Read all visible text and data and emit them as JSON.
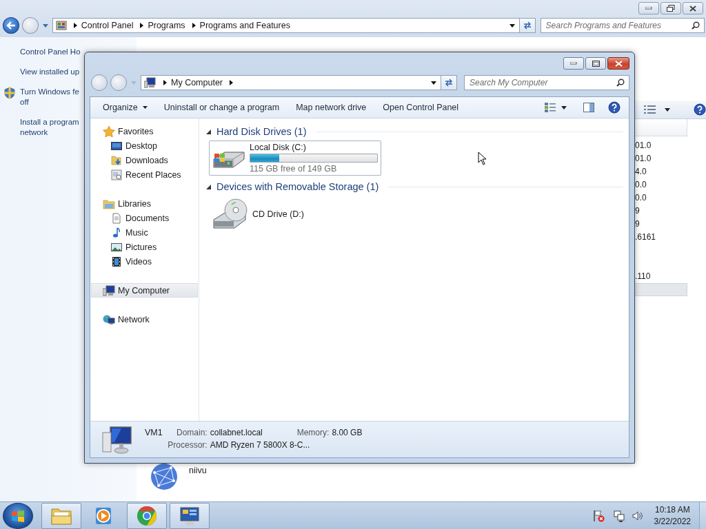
{
  "back_window": {
    "breadcrumb": [
      "Control Panel",
      "Programs",
      "Programs and Features"
    ],
    "search": {
      "placeholder": "Search Programs and Features"
    },
    "tasks": [
      {
        "lines": [
          "Control Panel Ho"
        ],
        "shield": false
      },
      {
        "lines": [
          "View installed up"
        ],
        "shield": false
      },
      {
        "lines": [
          "Turn Windows fe",
          "off"
        ],
        "shield": true
      },
      {
        "lines": [
          "Install a program",
          "network"
        ],
        "shield": false
      }
    ],
    "rows": [
      {
        "version": "01.0",
        "selected": false
      },
      {
        "version": "01.0",
        "selected": false
      },
      {
        "version": "4.0",
        "selected": false
      },
      {
        "version": "0.0",
        "selected": false
      },
      {
        "version": "0.0",
        "selected": false
      },
      {
        "version": "9",
        "selected": false
      },
      {
        "version": "9",
        "selected": false
      },
      {
        "version": ".6161",
        "selected": false
      },
      {
        "selected": false
      },
      {
        "selected": false
      },
      {
        "version": ".110",
        "selected": false
      },
      {
        "selected": true
      }
    ],
    "details": {
      "name": "niivu"
    }
  },
  "window": {
    "address": [
      "My Computer"
    ],
    "search": {
      "placeholder": "Search My Computer"
    },
    "toolbar": [
      {
        "label": "Organize",
        "menu": true
      },
      {
        "label": "Uninstall or change a program",
        "menu": false
      },
      {
        "label": "Map network drive",
        "menu": false
      },
      {
        "label": "Open Control Panel",
        "menu": false
      }
    ],
    "nav": [
      {
        "label": "Favorites",
        "kind": "star",
        "selected": false,
        "children": [
          {
            "label": "Desktop",
            "kind": "desktop",
            "selected": false
          },
          {
            "label": "Downloads",
            "kind": "downloads",
            "selected": false
          },
          {
            "label": "Recent Places",
            "kind": "recent",
            "selected": false
          }
        ]
      },
      {
        "label": "Libraries",
        "kind": "libraries",
        "selected": false,
        "children": [
          {
            "label": "Documents",
            "kind": "documents",
            "selected": false
          },
          {
            "label": "Music",
            "kind": "music",
            "selected": false
          },
          {
            "label": "Pictures",
            "kind": "pictures",
            "selected": false
          },
          {
            "label": "Videos",
            "kind": "videos",
            "selected": false
          }
        ]
      },
      {
        "label": "My Computer",
        "kind": "computer",
        "selected": true
      },
      {
        "label": "Network",
        "kind": "network",
        "selected": false
      }
    ],
    "groups": [
      {
        "title": "Hard Disk Drives (1)",
        "expanded": true,
        "items": [
          {
            "kind": "disk",
            "name": "Local Disk (C:)",
            "level": 0.23,
            "detail": "115 GB free of 149 GB",
            "selected": true
          }
        ]
      },
      {
        "title": "Devices with Removable Storage (1)",
        "expanded": true,
        "items": [
          {
            "kind": "cd",
            "name": "CD Drive (D:)",
            "selected": false
          }
        ]
      }
    ],
    "details": {
      "name": "VM1",
      "fields": [
        {
          "label": "Domain:",
          "value": "collabnet.local"
        },
        {
          "label": "Memory:",
          "value": "8.00 GB"
        },
        {
          "label": "Processor:",
          "value": "AMD Ryzen 7 5800X 8-C..."
        }
      ]
    }
  },
  "taskbar": {
    "apps": [
      {
        "kind": "folder",
        "active": true
      },
      {
        "kind": "media",
        "active": false
      },
      {
        "kind": "browser",
        "active": true
      },
      {
        "kind": "control-panel",
        "active": true
      }
    ],
    "time": "10:18 AM",
    "date": "3/22/2022"
  }
}
